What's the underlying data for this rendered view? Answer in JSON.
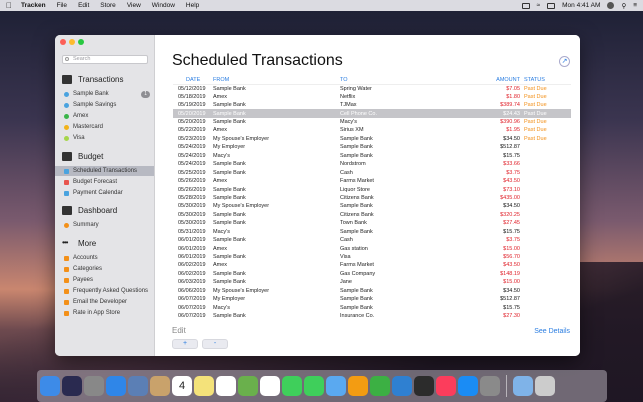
{
  "menubar": {
    "app": "Tracken",
    "items": [
      "File",
      "Edit",
      "Store",
      "View",
      "Window",
      "Help"
    ],
    "clock": "Mon 4:41 AM"
  },
  "sidebar": {
    "search_placeholder": "Search",
    "transactions_header": "Transactions",
    "transactions": [
      {
        "label": "Sample Bank",
        "color": "#4aa3df",
        "badge": "1"
      },
      {
        "label": "Sample Savings",
        "color": "#4aa3df"
      },
      {
        "label": "Amex",
        "color": "#3bb54a"
      },
      {
        "label": "Mastercard",
        "color": "#f2b31b"
      },
      {
        "label": "Visa",
        "color": "#a6d64b"
      }
    ],
    "budget_header": "Budget",
    "budget": [
      {
        "label": "Scheduled Transactions",
        "color": "#4aa3df"
      },
      {
        "label": "Budget Forecast",
        "color": "#e8554e"
      },
      {
        "label": "Payment Calendar",
        "color": "#4aa3df"
      }
    ],
    "dashboard_header": "Dashboard",
    "dashboard": [
      {
        "label": "Summary",
        "color": "#f39019"
      }
    ],
    "more_header": "More",
    "more": [
      {
        "label": "Accounts",
        "color": "#f39019"
      },
      {
        "label": "Categories",
        "color": "#f39019"
      },
      {
        "label": "Payees",
        "color": "#f39019"
      },
      {
        "label": "Frequently Asked Questions",
        "color": "#f39019"
      },
      {
        "label": "Email the Developer",
        "color": "#f39019"
      },
      {
        "label": "Rate in App Store",
        "color": "#f39019"
      }
    ]
  },
  "main": {
    "title": "Scheduled Transactions",
    "columns": [
      "DATE",
      "FROM",
      "TO",
      "AMOUNT",
      "STATUS"
    ],
    "rows": [
      [
        "05/12/2019",
        "Sample Bank",
        "Spring Water",
        "$7.05",
        "Past Due",
        "red"
      ],
      [
        "05/18/2019",
        "Amex",
        "Netflix",
        "$1.80",
        "Past Due",
        "red"
      ],
      [
        "05/19/2019",
        "Sample Bank",
        "TJMax",
        "$389.74",
        "Past Due",
        "red"
      ],
      [
        "05/20/2019",
        "Sample Bank",
        "Cell Phone Co.",
        "$24.43",
        "Past Due",
        "red"
      ],
      [
        "05/20/2019",
        "Sample Bank",
        "Macy's",
        "$390.96",
        "Past Due",
        "red"
      ],
      [
        "05/22/2019",
        "Amex",
        "Sirius XM",
        "$1.95",
        "Past Due",
        "red"
      ],
      [
        "05/23/2019",
        "My Spouse's Employer",
        "Sample Bank",
        "$34.50",
        "Past Due",
        "blk"
      ],
      [
        "05/24/2019",
        "My Employer",
        "Sample Bank",
        "$512.87",
        "",
        "blk"
      ],
      [
        "05/24/2019",
        "Macy's",
        "Sample Bank",
        "$15.75",
        "",
        "blk"
      ],
      [
        "05/24/2019",
        "Sample Bank",
        "Nordstrom",
        "$33.66",
        "",
        "red"
      ],
      [
        "05/25/2019",
        "Sample Bank",
        "Cash",
        "$3.75",
        "",
        "red"
      ],
      [
        "05/26/2019",
        "Amex",
        "Farms Market",
        "$43.50",
        "",
        "red"
      ],
      [
        "05/26/2019",
        "Sample Bank",
        "Liquor Store",
        "$73.10",
        "",
        "red"
      ],
      [
        "05/28/2019",
        "Sample Bank",
        "Citizens Bank",
        "$435.00",
        "",
        "red"
      ],
      [
        "05/30/2019",
        "My Spouse's Employer",
        "Sample Bank",
        "$34.50",
        "",
        "blk"
      ],
      [
        "05/30/2019",
        "Sample Bank",
        "Citizens Bank",
        "$320.25",
        "",
        "red"
      ],
      [
        "05/30/2019",
        "Sample Bank",
        "Town Bank",
        "$27.45",
        "",
        "red"
      ],
      [
        "05/31/2019",
        "Macy's",
        "Sample Bank",
        "$15.75",
        "",
        "blk"
      ],
      [
        "06/01/2019",
        "Sample Bank",
        "Cash",
        "$3.75",
        "",
        "red"
      ],
      [
        "06/01/2019",
        "Amex",
        "Gas station",
        "$15.00",
        "",
        "red"
      ],
      [
        "06/01/2019",
        "Sample Bank",
        "Visa",
        "$56.70",
        "",
        "red"
      ],
      [
        "06/02/2019",
        "Amex",
        "Farms Market",
        "$43.50",
        "",
        "red"
      ],
      [
        "06/02/2019",
        "Sample Bank",
        "Gas Company",
        "$148.19",
        "",
        "red"
      ],
      [
        "06/03/2019",
        "Sample Bank",
        "Jane",
        "$15.00",
        "",
        "red"
      ],
      [
        "06/06/2019",
        "My Spouse's Employer",
        "Sample Bank",
        "$34.50",
        "",
        "blk"
      ],
      [
        "06/07/2019",
        "My Employer",
        "Sample Bank",
        "$512.87",
        "",
        "blk"
      ],
      [
        "06/07/2019",
        "Macy's",
        "Sample Bank",
        "$15.75",
        "",
        "blk"
      ],
      [
        "06/07/2019",
        "Sample Bank",
        "Insurance Co.",
        "$27.30",
        "",
        "red"
      ]
    ],
    "selected_row": 3,
    "edit_label": "Edit",
    "add_label": "+",
    "remove_label": "-",
    "details_label": "See Details"
  },
  "dock": {
    "apps": [
      "Finder",
      "Siri",
      "Launchpad",
      "Safari",
      "Preview",
      "Contacts",
      "Calendar",
      "Notes",
      "Reminders",
      "Maps",
      "Photos",
      "Messages",
      "FaceTime",
      "Mail",
      "Pages",
      "Numbers",
      "Keynote",
      "Tracken",
      "Music",
      "App Store",
      "System Preferences",
      "Downloads",
      "Trash"
    ],
    "calendar_day": "4"
  }
}
